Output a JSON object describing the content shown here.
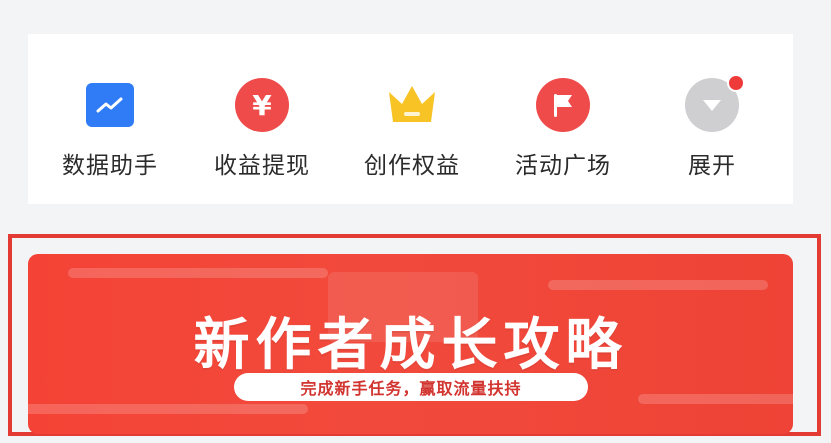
{
  "quick_actions": [
    {
      "label": "数据助手",
      "icon": "chart-icon"
    },
    {
      "label": "收益提现",
      "icon": "yen-icon",
      "symbol": "¥"
    },
    {
      "label": "创作权益",
      "icon": "crown-icon"
    },
    {
      "label": "活动广场",
      "icon": "flag-icon"
    },
    {
      "label": "展开",
      "icon": "expand-icon"
    }
  ],
  "banner": {
    "title": "新作者成长攻略",
    "subtitle": "完成新手任务，赢取流量扶持"
  },
  "colors": {
    "accent_red": "#ef4b4b",
    "blue": "#2f7cf6",
    "gold": "#f7c325",
    "gray": "#cfcfd1"
  }
}
